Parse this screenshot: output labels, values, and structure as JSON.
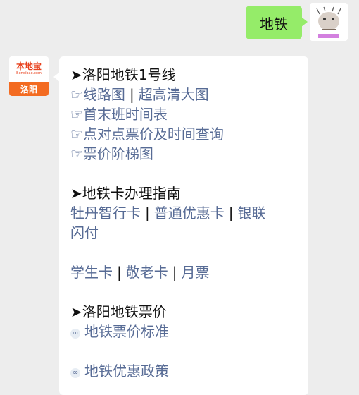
{
  "outgoing": {
    "text": "地铁"
  },
  "brand": {
    "name": "本地宝",
    "url": "Bendibao.com",
    "city": "洛阳"
  },
  "message": {
    "s1": {
      "title": "➤洛阳地铁1号线",
      "items": [
        {
          "hand": "☞",
          "a": "线路图",
          "sep": "|",
          "b": "超高清大图"
        },
        {
          "hand": "☞",
          "a": "首末班时间表"
        },
        {
          "hand": "☞",
          "a": "点对点票价及时间查询"
        },
        {
          "hand": "☞",
          "a": "票价阶梯图"
        }
      ]
    },
    "s2": {
      "title": "➤地铁卡办理指南",
      "row1": [
        "牡丹智行卡",
        "|",
        "普通优惠卡",
        "|",
        "银联"
      ],
      "row2": "闪付",
      "row3": [
        "学生卡",
        "|",
        "敬老卡",
        "|",
        "月票"
      ]
    },
    "s3": {
      "title": "➤洛阳地铁票价",
      "links": [
        "地铁票价标准",
        "地铁优惠政策"
      ]
    }
  },
  "icons": [
    "hand-pointing-right-icon",
    "link-chain-icon"
  ]
}
